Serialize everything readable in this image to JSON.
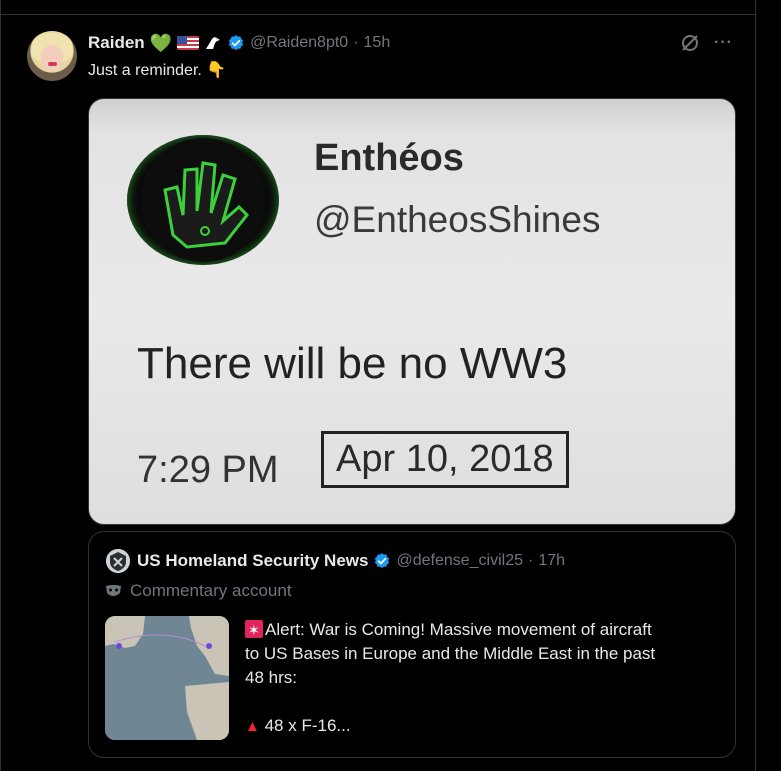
{
  "tweet": {
    "author_name": "Raiden",
    "handle": "@Raiden8pt0",
    "time": "15h",
    "separator": "·",
    "text": "Just a reminder.",
    "text_emoji": "👇",
    "name_emojis": {
      "heart": "💚"
    },
    "more_label": "···"
  },
  "media": {
    "name": "Enthéos",
    "handle": "@EntheosShines",
    "body": "There will be no WW3",
    "time": "7:29 PM",
    "date": "Apr 10, 2018"
  },
  "quote": {
    "author_name": "US Homeland Security News",
    "handle": "@defense_civil25",
    "separator": "·",
    "time": "17h",
    "label": "Commentary account",
    "text_line1": "Alert: War is Coming! Massive movement of aircraft",
    "text_line2": "to US Bases in Europe and the Middle East in the past",
    "text_line3": "48 hrs:",
    "text_line4": "48 x F-16..."
  },
  "colors": {
    "background": "#000000",
    "text_primary": "#e7e9ea",
    "text_secondary": "#71767b",
    "verified_blue": "#1d9bf0",
    "border": "#2f3336",
    "alert_red": "#f4212e"
  },
  "icons": [
    "green-heart-icon",
    "us-flag-icon",
    "eagle-icon",
    "verified-icon",
    "grok-icon",
    "more-icon",
    "pointing-down-icon",
    "siren-icon",
    "mask-icon",
    "triangle-icon"
  ]
}
